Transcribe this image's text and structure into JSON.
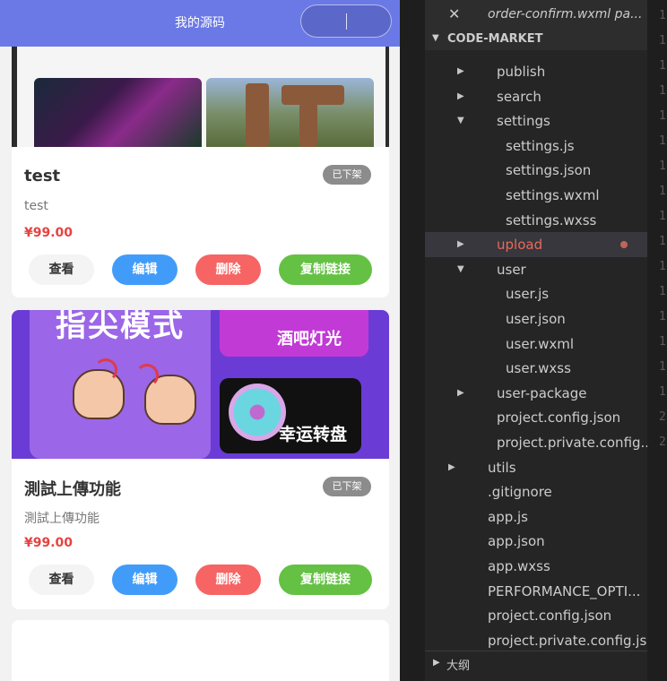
{
  "simulator": {
    "nav_title": "我的源码",
    "products": [
      {
        "title": "test",
        "desc": "test",
        "price": "¥99.00",
        "status": "已下架"
      },
      {
        "title": "測試上傳功能",
        "desc": "測試上傳功能",
        "price": "¥99.00",
        "status": "已下架",
        "cover_text": {
          "main": "指尖模式",
          "top_right": "酒吧灯光",
          "bottom_right": "幸运转盘"
        }
      }
    ],
    "buttons": {
      "view": "查看",
      "edit": "编辑",
      "delete": "删除",
      "copy": "复制链接"
    },
    "colors": {
      "nav": "#6b79e6",
      "edit": "#419cf9",
      "delete": "#f66464",
      "copy": "#64c144",
      "price": "#e64340"
    }
  },
  "explorer": {
    "tab": {
      "label": "order-confirm.wxml pa..."
    },
    "section_title": "CODE-MARKET",
    "items": [
      {
        "label": "publish",
        "indent": 1,
        "arrow": "right"
      },
      {
        "label": "search",
        "indent": 1,
        "arrow": "right"
      },
      {
        "label": "settings",
        "indent": 1,
        "arrow": "down"
      },
      {
        "label": "settings.js",
        "indent": 2
      },
      {
        "label": "settings.json",
        "indent": 2
      },
      {
        "label": "settings.wxml",
        "indent": 2
      },
      {
        "label": "settings.wxss",
        "indent": 2
      },
      {
        "label": "upload",
        "indent": 1,
        "arrow": "right"
      },
      {
        "label": "user",
        "indent": 1,
        "arrow": "down"
      },
      {
        "label": "user.js",
        "indent": 2
      },
      {
        "label": "user.json",
        "indent": 2
      },
      {
        "label": "user.wxml",
        "indent": 2
      },
      {
        "label": "user.wxss",
        "indent": 2
      },
      {
        "label": "user-package",
        "indent": 1,
        "arrow": "right"
      },
      {
        "label": "project.config.json",
        "indent": 1
      },
      {
        "label": "project.private.config....",
        "indent": 1
      },
      {
        "label": "utils",
        "indent": 0,
        "arrow": "right"
      },
      {
        "label": ".gitignore",
        "indent": 0
      },
      {
        "label": "app.js",
        "indent": 0
      },
      {
        "label": "app.json",
        "indent": 0
      },
      {
        "label": "app.wxss",
        "indent": 0
      },
      {
        "label": "PERFORMANCE_OPTI...",
        "indent": 0
      },
      {
        "label": "project.config.json",
        "indent": 0
      },
      {
        "label": "project.private.config.js...",
        "indent": 0
      }
    ],
    "outline_title": "大纲",
    "colors": {
      "sidebar": "#252526",
      "text": "#cccccc",
      "modified": "#e86a5a"
    }
  },
  "gutter": {
    "numbers": [
      "1",
      "1",
      "1",
      "1",
      "1",
      "1",
      "1",
      "1",
      "1",
      "1",
      "1",
      "1",
      "1",
      "1",
      "1",
      "1",
      "2",
      "2"
    ]
  }
}
